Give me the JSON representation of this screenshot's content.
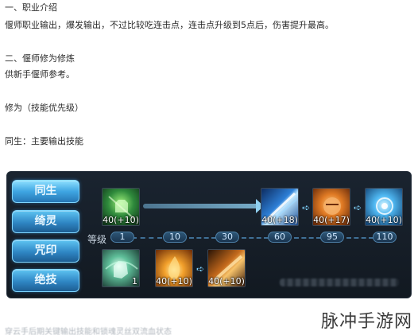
{
  "article": {
    "heading1": "一、职业介绍",
    "line1": "偃师职业输出，爆发输出，不过比较吃连击点，连击点升级到5点后，伤害提升最高。",
    "heading2": "二、偃师修为修炼",
    "line2": "供新手偃师参考。",
    "line3": "修为（技能优先级）",
    "line4": "同生：主要输出技能"
  },
  "panel": {
    "tabs": [
      {
        "label": "同生",
        "active": true
      },
      {
        "label": "绮灵",
        "active": false
      },
      {
        "label": "咒印",
        "active": false
      },
      {
        "label": "绝技",
        "active": false
      }
    ],
    "level_label": "等级",
    "levels": [
      "1",
      "10",
      "30",
      "60",
      "95",
      "110"
    ],
    "row1_skills": [
      {
        "icon": "green-fist-skill-icon",
        "cost": "40(+10)"
      },
      {
        "icon": "blue-slash-skill-icon",
        "cost": "40(+18)"
      },
      {
        "icon": "orange-fist-skill-icon",
        "cost": "40(+17)"
      },
      {
        "icon": "blue-orb-skill-icon",
        "cost": "40(+10)"
      }
    ],
    "row2_skills": [
      {
        "icon": "green-punch-skill-icon",
        "cost": "1"
      },
      {
        "icon": "fire-burst-skill-icon",
        "cost": "40(+10)"
      },
      {
        "icon": "flame-blade-skill-icon",
        "cost": "40(+10)"
      }
    ]
  },
  "caption": "穿云手后期关键输出技能和锁魂灵丝双流血状态",
  "watermark": "脉冲手游网",
  "colors": {
    "accent": "#3fa6e2",
    "panel_bg": "#141c26"
  }
}
